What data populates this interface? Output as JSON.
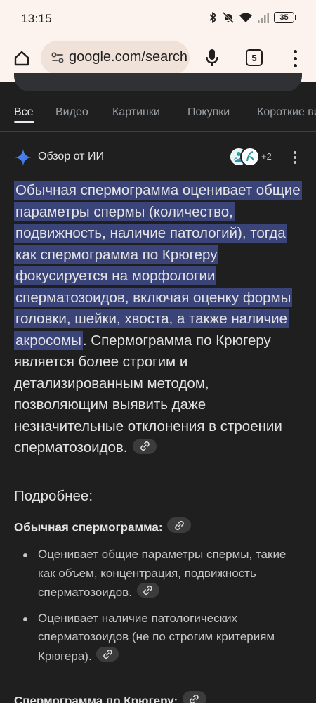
{
  "status_bar": {
    "time": "13:15",
    "battery": "35"
  },
  "browser": {
    "url": "google.com/search",
    "tab_count": "5"
  },
  "filter_tabs": [
    "Все",
    "Видео",
    "Картинки",
    "Покупки",
    "Короткие видео"
  ],
  "ai_overview": {
    "title": "Обзор от ИИ",
    "more_sources": "+2",
    "summary_highlighted": "Обычная спермограмма оценивает общие параметры спермы (количество, подвижность, наличие патологий), тогда как спермограмма по Крюгеру фокусируется на морфологии сперматозоидов, включая оценку формы головки, шейки, хвоста, а также наличие акросомы",
    "summary_rest": ". Спермограмма по Крюгеру является более строгим и детализированным методом, позволяющим выявить даже незначительные отклонения в строении сперматозоидов.",
    "details_title": "Подробнее:",
    "sections": [
      {
        "title": "Обычная спермограмма:",
        "bullets": [
          "Оценивает общие параметры спермы, такие как объем, концентрация, подвижность сперматозоидов.",
          "Оценивает наличие патологических сперматозоидов (не по строгим критериям Крюгера)."
        ]
      },
      {
        "title": "Спермограмма по Крюгеру:"
      }
    ]
  },
  "icons": {
    "home": "home-icon",
    "site_settings": "site-settings-icon",
    "mic": "mic-icon",
    "menu": "more-vert-icon",
    "ai": "gemini-spark-icon",
    "link": "link-icon"
  },
  "colors": {
    "toolbar_bg": "#fcf3ee",
    "omnibox_bg": "#f0e2d9",
    "page_bg": "#1f1f1f",
    "highlight": "#3b4478",
    "ai_spark": "#4f8ef7"
  }
}
